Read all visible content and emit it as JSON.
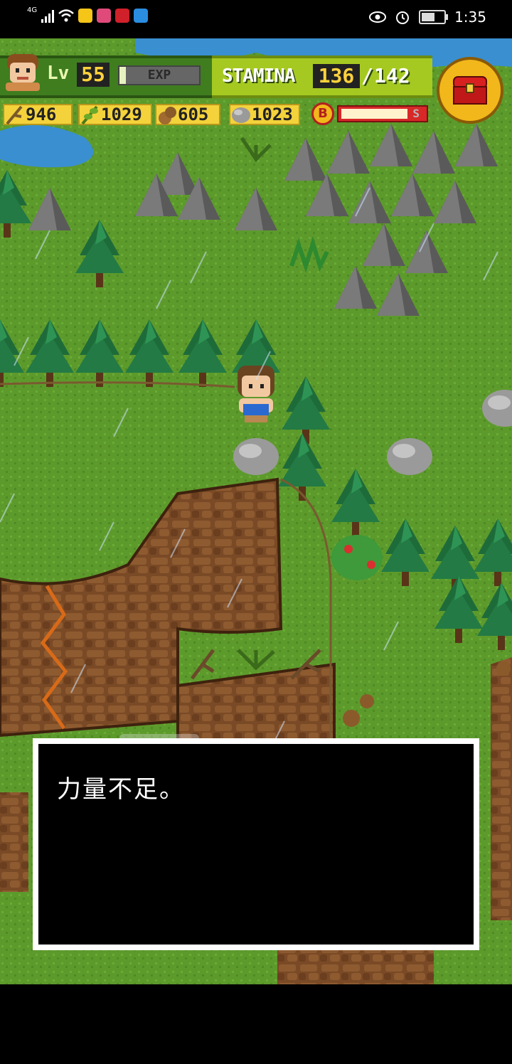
{
  "status_bar": {
    "network": "4G",
    "time": "1:35",
    "app_icons": [
      "star-app-icon",
      "face-app-icon",
      "huawei-app-icon",
      "browser-app-icon"
    ]
  },
  "hud": {
    "level_label": "Lv",
    "level": "55",
    "exp_label": "EXP",
    "exp_fraction": 0.08,
    "stamina_label": "STAMINA",
    "stamina_current": "136",
    "stamina_separator": "/",
    "stamina_max": "142",
    "resources": [
      {
        "icon": "branch-icon",
        "value": "946"
      },
      {
        "icon": "herb-icon",
        "value": "1029"
      },
      {
        "icon": "nut-icon",
        "value": "605"
      },
      {
        "icon": "stone-icon",
        "value": "1023"
      }
    ],
    "boost_label": "B",
    "boost_end_label": "S",
    "boost_fraction": 0.75
  },
  "dialog": {
    "message": "力量不足。"
  },
  "colors": {
    "grass": "#5d9a2c",
    "hud_green": "#3f7d1f",
    "stamina_green": "#a6c922",
    "gold": "#f2b71a",
    "dialog_bg": "#000000"
  }
}
